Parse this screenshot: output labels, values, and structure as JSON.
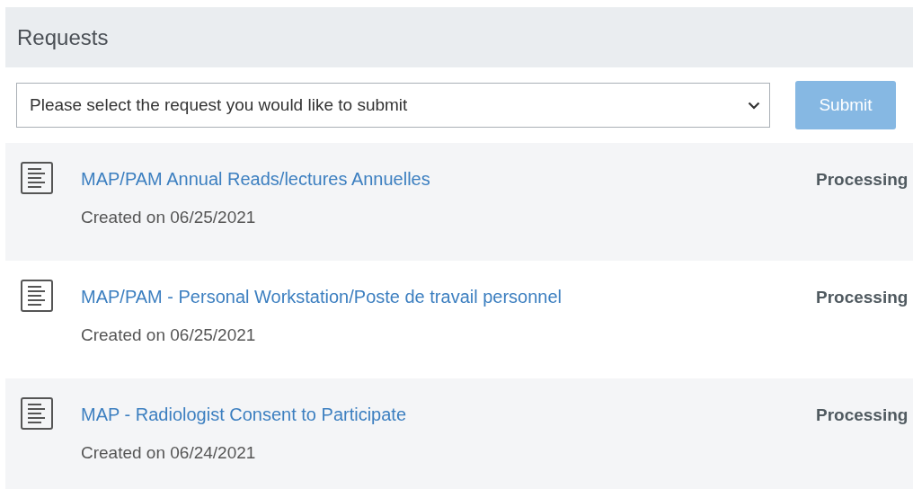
{
  "header": {
    "title": "Requests"
  },
  "request_select": {
    "placeholder": "Please select the request you would like to submit"
  },
  "submit_button": {
    "label": "Submit",
    "disabled": true
  },
  "requests": [
    {
      "title": "MAP/PAM Annual Reads/lectures Annuelles",
      "created": "Created on 06/25/2021",
      "status": "Processing"
    },
    {
      "title": "MAP/PAM - Personal Workstation/Poste de travail personnel",
      "created": "Created on 06/25/2021",
      "status": "Processing"
    },
    {
      "title": "MAP - Radiologist Consent to Participate",
      "created": "Created on 06/24/2021",
      "status": "Processing"
    }
  ]
}
